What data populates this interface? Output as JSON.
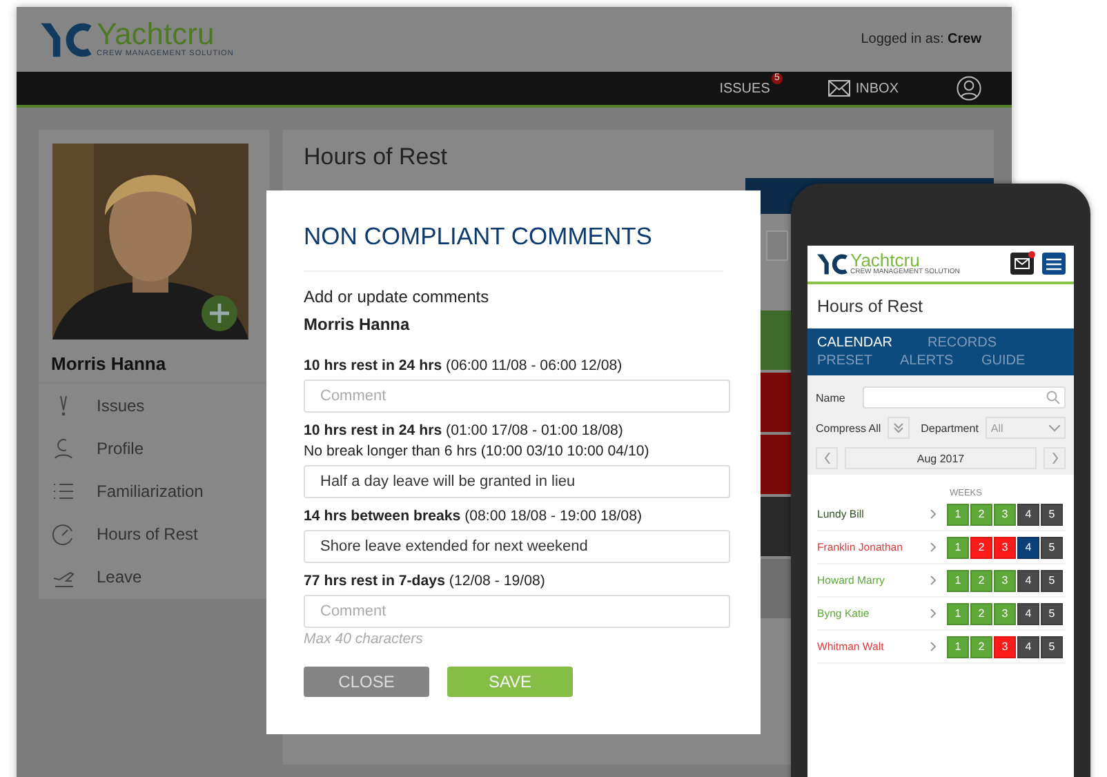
{
  "desktop": {
    "logo": {
      "name": "Yachtcru",
      "tagline": "CREW MANAGEMENT SOLUTION"
    },
    "logged_in_label": "Logged in as:",
    "user": "Crew",
    "nav": [
      {
        "kind": "issues",
        "label": "ISSUES",
        "badge": "5"
      },
      {
        "kind": "inbox",
        "label": "INBOX"
      },
      {
        "kind": "account"
      }
    ],
    "profile": {
      "name": "Morris Hanna"
    },
    "sidebar": {
      "items": [
        {
          "kind": "issues",
          "label": "Issues"
        },
        {
          "kind": "profile",
          "label": "Profile"
        },
        {
          "kind": "list",
          "label": "Familiarization"
        },
        {
          "kind": "clock",
          "label": "Hours of Rest"
        },
        {
          "kind": "plane",
          "label": "Leave"
        }
      ]
    },
    "page_title": "Hours of Rest",
    "calendar_cells": [
      {
        "color": "#3f6a2a"
      },
      {
        "color": "#7a0a0a"
      },
      {
        "color": "#7a0a0a"
      },
      {
        "color": "#2a2a2a"
      },
      {
        "color": "#6e6e6e"
      }
    ]
  },
  "modal": {
    "title": "NON COMPLIANT COMMENTS",
    "subtitle": "Add or update comments",
    "crew_name": "Morris Hanna",
    "items": [
      {
        "lines": [
          "**10 hrs rest in 24 hrs** (06:00 11/08 - 06:00 12/08)"
        ],
        "placeholder": "Comment"
      },
      {
        "lines": [
          "**10 hrs rest in 24 hrs** (01:00 17/08 - 01:00 18/08)",
          "No break longer than 6 hrs (10:00 03/10 10:00 04/10)"
        ],
        "value": "Half a day leave will be granted in lieu"
      },
      {
        "lines": [
          "**14 hrs between breaks** (08:00 18/08 - 19:00 18/08)"
        ],
        "value": "Shore leave extended for next weekend"
      },
      {
        "lines": [
          "**77 hrs rest in 7-days** (12/08 - 19/08)"
        ],
        "placeholder": "Comment"
      }
    ],
    "hint": "Max 40 characters",
    "buttons": [
      {
        "kind": "secondary",
        "label": "CLOSE"
      },
      {
        "kind": "primary",
        "label": "SAVE"
      }
    ]
  },
  "phone": {
    "logo": {
      "name": "Yachtcru",
      "tagline": "CREW MANAGEMENT SOLUTION"
    },
    "title": "Hours of Rest",
    "tabs": [
      {
        "label": "CALENDAR",
        "selected": true
      },
      {
        "label": "RECORDS",
        "selected": false
      },
      {
        "label": "PRESET",
        "selected": false
      },
      {
        "label": "ALERTS",
        "selected": false
      },
      {
        "label": "GUIDE",
        "selected": false
      }
    ],
    "name_label": "Name",
    "compress_label": "Compress All",
    "department_label": "Department",
    "department_value": "All",
    "month": "Aug 2017",
    "weeks_label": "WEEKS",
    "crew": [
      {
        "name": "Lundy Bill",
        "color": "#2f4f22",
        "weeks": [
          {
            "label": "1",
            "color": "#5fa83a"
          },
          {
            "label": "2",
            "color": "#5fa83a"
          },
          {
            "label": "3",
            "color": "#5fa83a"
          },
          {
            "label": "4",
            "color": "#4a4a4a"
          },
          {
            "label": "5",
            "color": "#4a4a4a"
          }
        ]
      },
      {
        "name": "Franklin Jonathan",
        "color": "#e03a3a",
        "weeks": [
          {
            "label": "1",
            "color": "#5fa83a"
          },
          {
            "label": "2",
            "color": "#ff1a1a"
          },
          {
            "label": "3",
            "color": "#ff1a1a"
          },
          {
            "label": "4",
            "color": "#0b3f7a"
          },
          {
            "label": "5",
            "color": "#4a4a4a"
          }
        ]
      },
      {
        "name": "Howard Marry",
        "color": "#5fa83a",
        "weeks": [
          {
            "label": "1",
            "color": "#5fa83a"
          },
          {
            "label": "2",
            "color": "#5fa83a"
          },
          {
            "label": "3",
            "color": "#5fa83a"
          },
          {
            "label": "4",
            "color": "#4a4a4a"
          },
          {
            "label": "5",
            "color": "#4a4a4a"
          }
        ]
      },
      {
        "name": "Byng Katie",
        "color": "#5fa83a",
        "weeks": [
          {
            "label": "1",
            "color": "#5fa83a"
          },
          {
            "label": "2",
            "color": "#5fa83a"
          },
          {
            "label": "3",
            "color": "#5fa83a"
          },
          {
            "label": "4",
            "color": "#4a4a4a"
          },
          {
            "label": "5",
            "color": "#4a4a4a"
          }
        ]
      },
      {
        "name": "Whitman Walt",
        "color": "#e03a3a",
        "weeks": [
          {
            "label": "1",
            "color": "#5fa83a"
          },
          {
            "label": "2",
            "color": "#5fa83a"
          },
          {
            "label": "3",
            "color": "#ff1a1a"
          },
          {
            "label": "4",
            "color": "#4a4a4a"
          },
          {
            "label": "5",
            "color": "#4a4a4a"
          }
        ]
      }
    ]
  }
}
